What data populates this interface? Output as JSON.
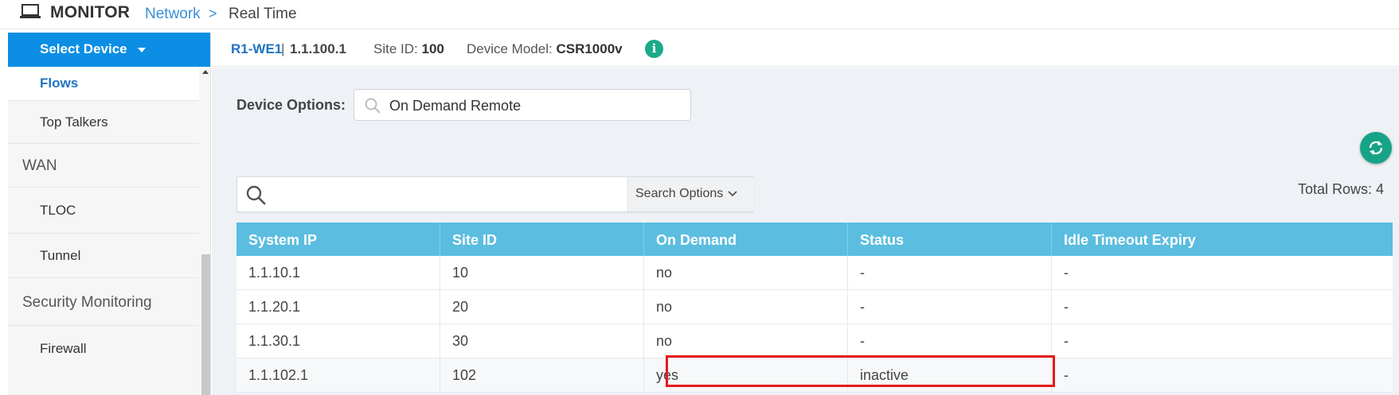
{
  "header": {
    "title": "MONITOR",
    "breadcrumb_network": "Network",
    "breadcrumb_separator": ">",
    "breadcrumb_current": "Real Time"
  },
  "sidebar": {
    "select_device_label": "Select Device",
    "items": [
      {
        "label": "Flows",
        "type": "item",
        "active": true
      },
      {
        "label": "Top Talkers",
        "type": "item",
        "active": false
      },
      {
        "label": "WAN",
        "type": "section",
        "active": false
      },
      {
        "label": "TLOC",
        "type": "item",
        "active": false
      },
      {
        "label": "Tunnel",
        "type": "item",
        "active": false
      },
      {
        "label": "Security Monitoring",
        "type": "section",
        "active": false
      },
      {
        "label": "Firewall",
        "type": "item",
        "active": false
      }
    ]
  },
  "device_info": {
    "hostname": "R1-WE1",
    "separator": "|",
    "system_ip": "1.1.100.1",
    "site_id_label": "Site ID:",
    "site_id_value": "100",
    "model_label": "Device Model:",
    "model_value": "CSR1000v",
    "info_icon_glyph": "i"
  },
  "device_options": {
    "label": "Device Options:",
    "value": "On Demand Remote"
  },
  "search": {
    "placeholder": "",
    "options_label": "Search Options"
  },
  "total_rows_text": "Total Rows: 4",
  "table": {
    "columns": [
      "System IP",
      "Site ID",
      "On Demand",
      "Status",
      "Idle Timeout Expiry"
    ],
    "rows": [
      [
        "1.1.10.1",
        "10",
        "no",
        "-",
        "-"
      ],
      [
        "1.1.20.1",
        "20",
        "no",
        "-",
        "-"
      ],
      [
        "1.1.30.1",
        "30",
        "no",
        "-",
        "-"
      ],
      [
        "1.1.102.1",
        "102",
        "yes",
        "inactive",
        "-"
      ]
    ]
  },
  "colors": {
    "accent_blue": "#0b8ee4",
    "table_header": "#5bbde0",
    "refresh_green": "#16a386",
    "highlight_red": "#e51b1b"
  },
  "icons": {
    "monitor": "laptop-icon",
    "refresh": "refresh-icon",
    "search": "search-icon",
    "info": "info-icon"
  }
}
